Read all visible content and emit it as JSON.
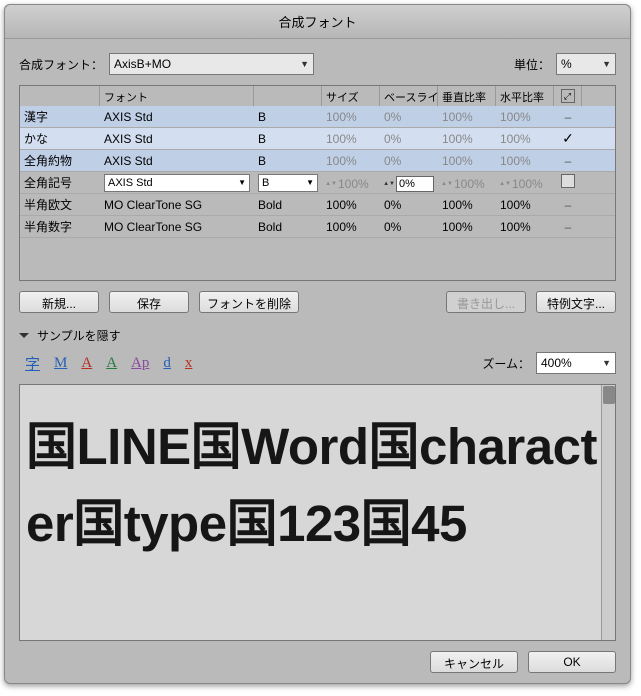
{
  "title": "合成フォント",
  "labels": {
    "fontLabel": "合成フォント：",
    "unitLabel": "単位："
  },
  "selectedFont": "AxisB+MO",
  "unit": "%",
  "columns": {
    "cat": "",
    "font": "フォント",
    "style": "",
    "size": "サイズ",
    "baseline": "ベースライ...",
    "vscale": "垂直比率",
    "hscale": "水平比率"
  },
  "rows": [
    {
      "cat": "漢字",
      "font": "AXIS Std",
      "style": "B",
      "size": "100%",
      "base": "0%",
      "v": "100%",
      "h": "100%",
      "sel": "blue",
      "mark": "dash"
    },
    {
      "cat": "かな",
      "font": "AXIS Std",
      "style": "B",
      "size": "100%",
      "base": "0%",
      "v": "100%",
      "h": "100%",
      "sel": "blue2",
      "mark": "check"
    },
    {
      "cat": "全角約物",
      "font": "AXIS Std",
      "style": "B",
      "size": "100%",
      "base": "0%",
      "v": "100%",
      "h": "100%",
      "sel": "blue",
      "mark": "dash"
    },
    {
      "cat": "全角記号",
      "font": "AXIS Std",
      "style": "B",
      "size": "100%",
      "base": "0%",
      "v": "100%",
      "h": "100%",
      "sel": "off",
      "mark": "box",
      "editable": true
    },
    {
      "cat": "半角欧文",
      "font": "MO ClearTone SG",
      "style": "Bold",
      "size": "100%",
      "base": "0%",
      "v": "100%",
      "h": "100%",
      "sel": "off",
      "mark": "dash"
    },
    {
      "cat": "半角数字",
      "font": "MO ClearTone SG",
      "style": "Bold",
      "size": "100%",
      "base": "0%",
      "v": "100%",
      "h": "100%",
      "sel": "off",
      "mark": "dash"
    }
  ],
  "buttons": {
    "new": "新規...",
    "save": "保存",
    "deleteFont": "フォントを削除",
    "export": "書き出し...",
    "special": "特例文字..."
  },
  "disclosure": "サンプルを隠す",
  "toolIcons": [
    "字",
    "M",
    "A",
    "A",
    "Ap",
    "d",
    "x"
  ],
  "zoomLabel": "ズーム：",
  "zoomValue": "400%",
  "sampleText": "国LINE国Word国character国type国123国45",
  "footer": {
    "cancel": "キャンセル",
    "ok": "OK"
  }
}
